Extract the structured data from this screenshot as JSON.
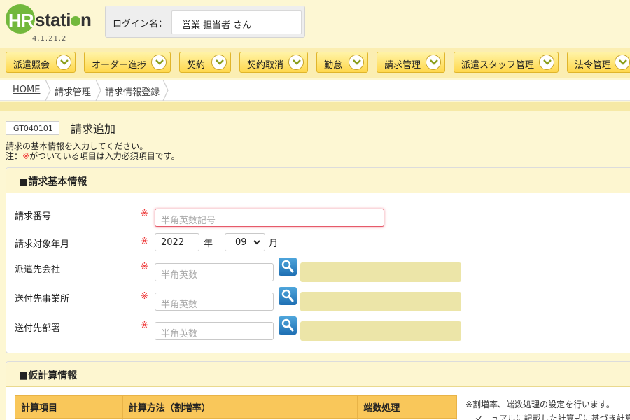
{
  "app": {
    "logo_text": "HRstation",
    "version": "4.1.21.2",
    "login_label": "ログイン名：",
    "login_name": "営業 担当者 さん"
  },
  "nav": {
    "items": [
      {
        "label": "派遣照会"
      },
      {
        "label": "オーダー進捗"
      },
      {
        "label": "契約"
      },
      {
        "label": "契約取消"
      },
      {
        "label": "勤怠"
      },
      {
        "label": "請求管理"
      },
      {
        "label": "派遣スタッフ管理"
      },
      {
        "label": "法令管理"
      }
    ]
  },
  "breadcrumb": [
    "HOME",
    "請求管理",
    "請求情報登録"
  ],
  "page": {
    "id": "GT040101",
    "title": "請求追加",
    "desc_line1": "請求の基本情報を入力してください。",
    "desc_note_prefix": "注：",
    "desc_note_mark": "※",
    "desc_note_rest": "がついている項目は入力必須項目です。"
  },
  "basic": {
    "heading": "■請求基本情報",
    "required_mark": "※",
    "fields": {
      "invoice_no": {
        "label": "請求番号",
        "placeholder": "半角英数記号",
        "value": ""
      },
      "target_month": {
        "label": "請求対象年月",
        "year": "2022",
        "year_unit": "年",
        "month": "09",
        "month_unit": "月"
      },
      "client": {
        "label": "派遣先会社",
        "placeholder": "半角英数"
      },
      "office": {
        "label": "送付先事業所",
        "placeholder": "半角英数"
      },
      "dept": {
        "label": "送付先部署",
        "placeholder": "半角英数"
      }
    }
  },
  "calc": {
    "heading": "■仮計算情報",
    "columns": [
      "計算項目",
      "計算方法（割増率）",
      "端数処理"
    ],
    "note1": "※割増率、端数処理の設定を行います。",
    "note2": "マニュアルに記載した計算式に基づき計算を"
  },
  "colors": {
    "accent": "#ffd84d",
    "logo_green": "#72b83c",
    "search_blue": "#1e6fb3",
    "required_red": "#e33333"
  }
}
